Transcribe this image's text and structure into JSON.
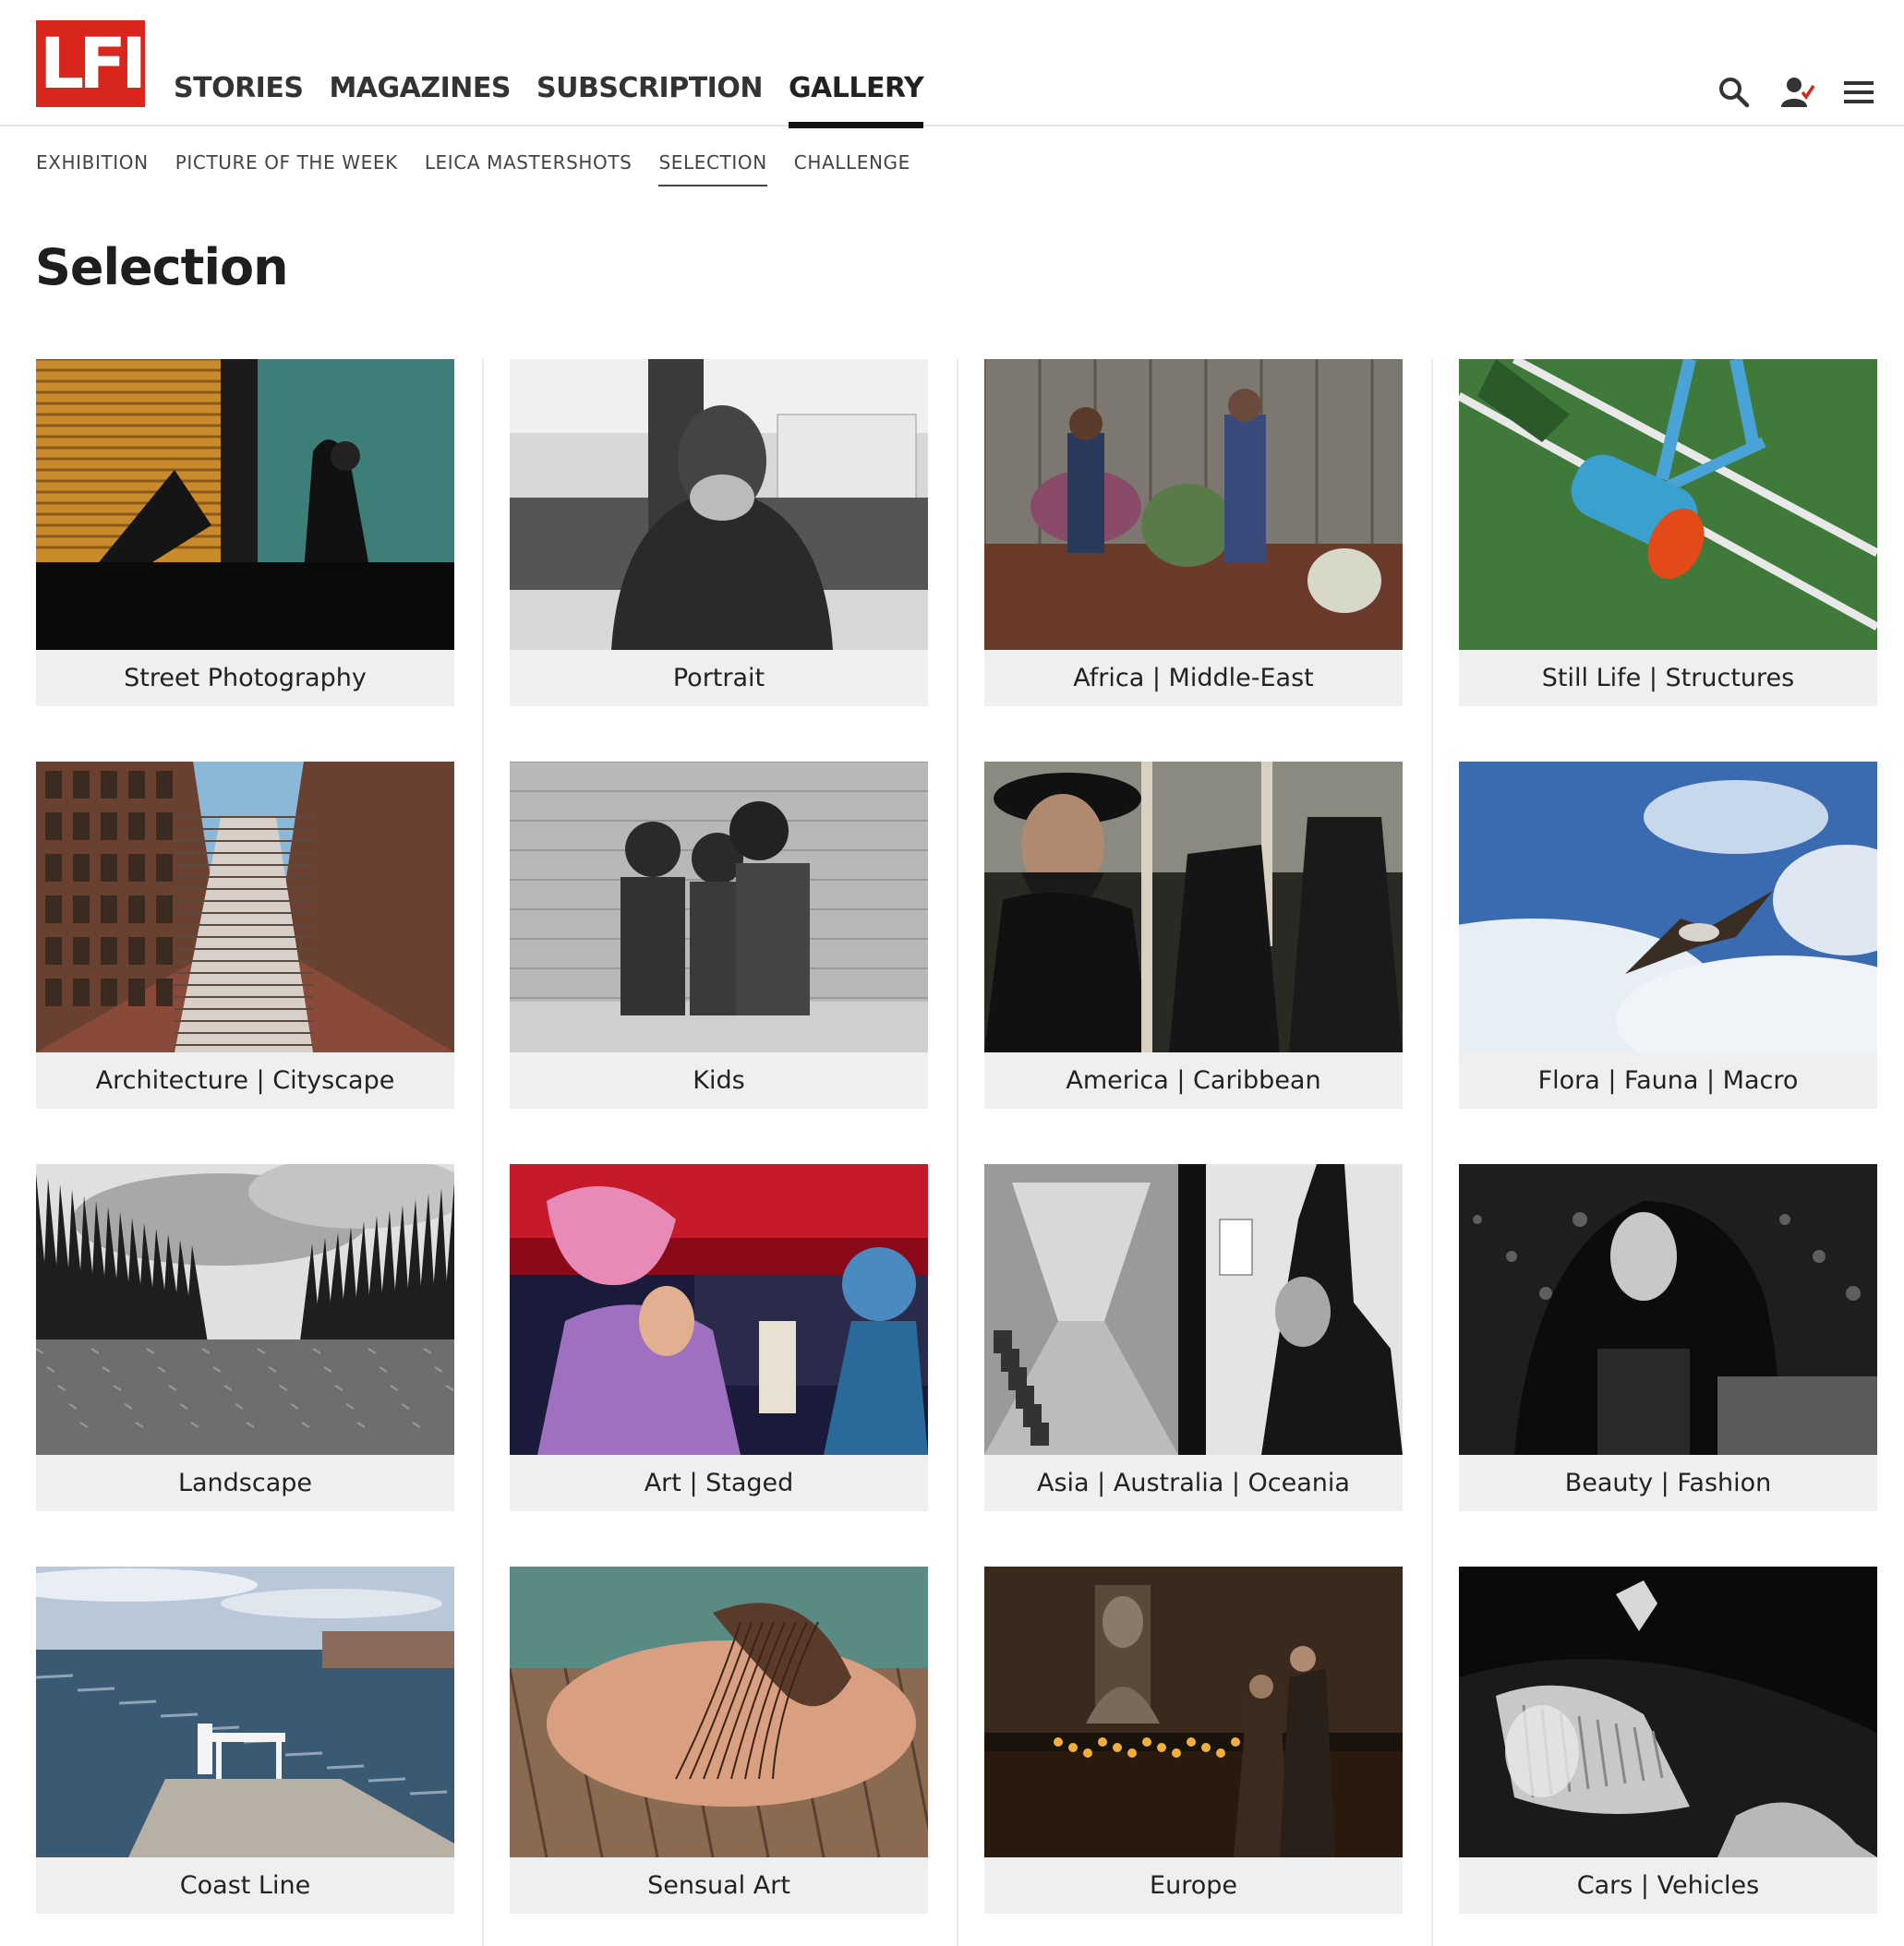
{
  "logo": {
    "text": "LFI",
    "color": "#d9261c"
  },
  "main_nav": [
    {
      "label": "STORIES",
      "active": false
    },
    {
      "label": "MAGAZINES",
      "active": false
    },
    {
      "label": "SUBSCRIPTION",
      "active": false
    },
    {
      "label": "GALLERY",
      "active": true
    }
  ],
  "tools": [
    "search-icon",
    "user-icon",
    "menu-icon"
  ],
  "sub_nav": [
    {
      "label": "EXHIBITION",
      "active": false
    },
    {
      "label": "PICTURE OF THE WEEK",
      "active": false
    },
    {
      "label": "LEICA MASTERSHOTS",
      "active": false
    },
    {
      "label": "SELECTION",
      "active": true
    },
    {
      "label": "CHALLENGE",
      "active": false
    }
  ],
  "page_title": "Selection",
  "categories": [
    {
      "label": "Street Photography",
      "tone": "street"
    },
    {
      "label": "Portrait",
      "tone": "bw-portrait"
    },
    {
      "label": "Africa | Middle-East",
      "tone": "market"
    },
    {
      "label": "Still Life | Structures",
      "tone": "turf"
    },
    {
      "label": "Architecture | Cityscape",
      "tone": "towers"
    },
    {
      "label": "Kids",
      "tone": "bw-kids"
    },
    {
      "label": "America | Caribbean",
      "tone": "dark-crowd"
    },
    {
      "label": "Flora | Fauna | Macro",
      "tone": "sky-bird"
    },
    {
      "label": "Landscape",
      "tone": "bw-forest"
    },
    {
      "label": "Art | Staged",
      "tone": "festival"
    },
    {
      "label": "Asia | Australia | Oceania",
      "tone": "bw-train"
    },
    {
      "label": "Beauty | Fashion",
      "tone": "bw-fashion"
    },
    {
      "label": "Coast Line",
      "tone": "coast"
    },
    {
      "label": "Sensual Art",
      "tone": "pier"
    },
    {
      "label": "Europe",
      "tone": "candles"
    },
    {
      "label": "Cars | Vehicles",
      "tone": "bw-car"
    }
  ]
}
